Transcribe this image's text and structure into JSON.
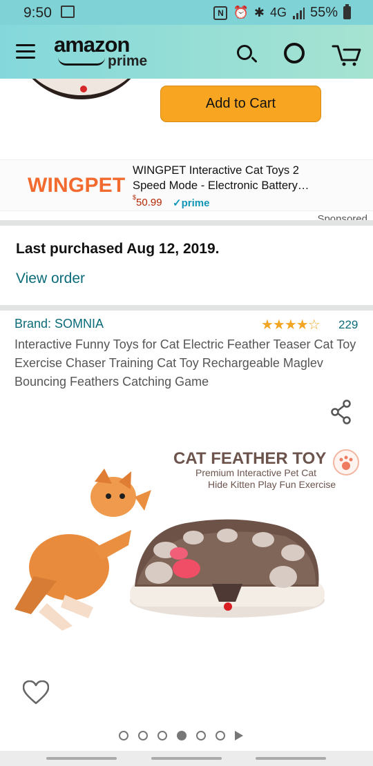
{
  "status": {
    "time": "9:50",
    "battery_percent": "55%",
    "network": "4G",
    "icons": [
      "gallery-icon",
      "nfc-icon",
      "alarm-icon",
      "bluetooth-icon",
      "signal-icon",
      "battery-icon"
    ]
  },
  "header": {
    "logo_top": "amazon",
    "logo_bottom": "prime",
    "icons": [
      "menu-icon",
      "search-icon",
      "alexa-icon",
      "cart-icon"
    ]
  },
  "top_ad": {
    "button_label": "Add to Cart"
  },
  "sponsored_ad": {
    "brand_logo": "WINGPET",
    "title_line1": "WINGPET Interactive Cat Toys 2",
    "title_line2": "Speed Mode - Electronic Battery…",
    "price_symbol": "$",
    "price_value": "50.99",
    "prime_label": "✓prime",
    "sponsored_label": "Sponsored"
  },
  "purchase": {
    "last_purchased": "Last purchased Aug 12, 2019.",
    "view_order": "View order"
  },
  "product": {
    "brand": "Brand: SOMNIA",
    "rating_stars": 3.5,
    "stars_display": "★★★★☆",
    "review_count": "229",
    "title": "Interactive Funny Toys for Cat Electric Feather Teaser Cat Toy Exercise Chaser Training Cat Toy Rechargeable Maglev Bouncing Feathers Catching Game",
    "image_heading": "CAT FEATHER TOY",
    "image_subheading_line1": "Premium Interactive Pet Cat",
    "image_subheading_line2": "Hide Kitten Play Fun Exercise",
    "carousel_count": 6,
    "carousel_active": 4
  },
  "colors": {
    "accent_teal": "#0b6b78",
    "button_orange": "#f8a622",
    "header_teal": "#84d8db",
    "star_orange": "#f2a521",
    "price_red": "#b12704"
  }
}
